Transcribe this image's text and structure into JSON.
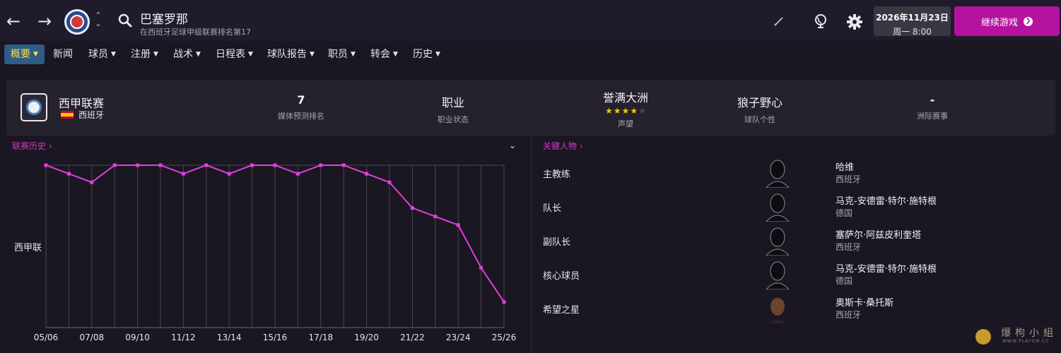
{
  "header": {
    "club_name": "巴塞罗那",
    "club_subtitle": "在西班牙足球甲级联赛排名第17",
    "date": "2026年11月23日",
    "time": "周一 8:00",
    "continue_label": "继续游戏"
  },
  "menu": [
    {
      "label": "概要",
      "active": true
    },
    {
      "label": "新闻",
      "active": false,
      "no_chevron": true
    },
    {
      "label": "球员",
      "active": false
    },
    {
      "label": "注册",
      "active": false
    },
    {
      "label": "战术",
      "active": false
    },
    {
      "label": "日程表",
      "active": false
    },
    {
      "label": "球队报告",
      "active": false
    },
    {
      "label": "职员",
      "active": false
    },
    {
      "label": "转会",
      "active": false
    },
    {
      "label": "历史",
      "active": false
    }
  ],
  "info": {
    "league_name": "西甲联赛",
    "country": "西班牙",
    "media_rank_value": "7",
    "media_rank_label": "媒体预测排名",
    "status_value": "职业",
    "status_label": "职业状态",
    "reputation_value": "誉满大洲",
    "reputation_label": "声望",
    "reputation_stars": 4,
    "reputation_stars_max": 5,
    "personality_value": "狼子野心",
    "personality_label": "球队个性",
    "continental_value": "-",
    "continental_label": "洲际赛事"
  },
  "league_history": {
    "link_label": "联赛历史",
    "league_label": "西甲联"
  },
  "key_people": {
    "link_label": "关键人物",
    "rows": [
      {
        "role": "主教练",
        "name": "哈维",
        "nationality": "西班牙",
        "photo": "silhouette"
      },
      {
        "role": "队长",
        "name": "马克-安德雷·特尔·施特根",
        "nationality": "德国",
        "photo": "silhouette"
      },
      {
        "role": "副队长",
        "name": "塞萨尔·阿兹皮利奎塔",
        "nationality": "西班牙",
        "photo": "silhouette"
      },
      {
        "role": "核心球员",
        "name": "马克-安德雷·特尔·施特根",
        "nationality": "德国",
        "photo": "silhouette"
      },
      {
        "role": "希望之星",
        "name": "奥斯卡·桑托斯",
        "nationality": "西班牙",
        "photo": "face"
      }
    ]
  },
  "watermark": {
    "text": "爆枸小組",
    "url": "WWW.PLAYGM.CC"
  },
  "colors": {
    "accent": "#b3139e",
    "line": "#e040d8",
    "link": "#d936c4",
    "active_tab_bg": "#2f5b86",
    "active_tab_text": "#f5e04a"
  },
  "chart_data": {
    "type": "line",
    "categories": [
      "05/06",
      "06/07",
      "07/08",
      "08/09",
      "09/10",
      "10/11",
      "11/12",
      "12/13",
      "13/14",
      "14/15",
      "15/16",
      "16/17",
      "17/18",
      "18/19",
      "19/20",
      "20/21",
      "21/22",
      "22/23",
      "23/24",
      "24/25",
      "25/26"
    ],
    "tick_labels": [
      "05/06",
      "07/08",
      "09/10",
      "11/12",
      "13/14",
      "15/16",
      "17/18",
      "19/20",
      "21/22",
      "23/24",
      "25/26"
    ],
    "series": [
      {
        "values": [
          1,
          2,
          3,
          1,
          1,
          1,
          2,
          1,
          2,
          1,
          1,
          2,
          1,
          1,
          2,
          3,
          6,
          7,
          8,
          13,
          17
        ]
      }
    ],
    "ylabel": "西甲联",
    "ylim": [
      1,
      20
    ],
    "y_inverted": true,
    "grid": true
  }
}
